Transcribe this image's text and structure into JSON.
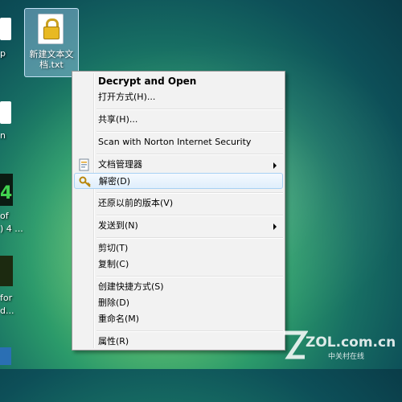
{
  "desktop": {
    "selected_file_label": "新建文本文档.txt",
    "edge_fragments": [
      "p",
      "n",
      "4",
      "of",
      ") 4 ...",
      "for",
      "d..."
    ]
  },
  "context_menu": {
    "items": [
      {
        "label": "Decrypt and Open",
        "bold": true
      },
      {
        "label": "打开方式(H)..."
      },
      {
        "label": "共享(H)..."
      },
      {
        "label": "Scan with Norton Internet Security"
      },
      {
        "label": "文档管理器",
        "submenu": true,
        "icon": "document-manager-icon"
      },
      {
        "label": "解密(D)",
        "highlighted": true,
        "icon": "key-icon"
      },
      {
        "label": "还原以前的版本(V)"
      },
      {
        "label": "发送到(N)",
        "submenu": true
      },
      {
        "label": "剪切(T)"
      },
      {
        "label": "复制(C)"
      },
      {
        "label": "创建快捷方式(S)"
      },
      {
        "label": "删除(D)"
      },
      {
        "label": "重命名(M)"
      },
      {
        "label": "属性(R)"
      }
    ]
  },
  "watermark": {
    "text": "ZOL.com.cn",
    "subtext": "中关村在线"
  },
  "colors": {
    "menu_background": "#f2f2f2",
    "highlight_border": "#a8d1f3",
    "desktop_accent": "#2b9a6a"
  }
}
